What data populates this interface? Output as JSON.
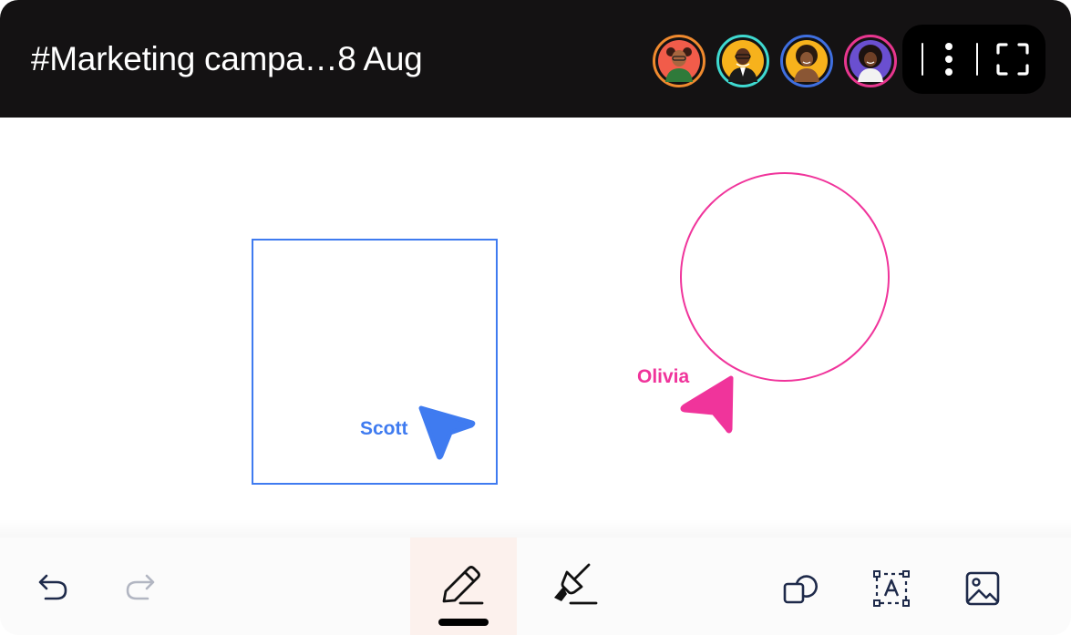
{
  "header": {
    "title": "#Marketing campa…8 Aug",
    "participants": [
      {
        "ring_color": "#f08a2e",
        "bg": "#f15c4a",
        "icon": "avatar-participant-1"
      },
      {
        "ring_color": "#3fd9d0",
        "bg": "#f7b21c",
        "icon": "avatar-participant-2"
      },
      {
        "ring_color": "#3f6fe0",
        "bg": "#f7b21c",
        "icon": "avatar-participant-3"
      },
      {
        "ring_color": "#e8368f",
        "bg": "#6a4fd0",
        "icon": "avatar-participant-4"
      }
    ],
    "actions": [
      "more-options-icon",
      "fullscreen-icon"
    ]
  },
  "canvas": {
    "cursors": [
      {
        "name": "Scott",
        "color": "#3f7bf0"
      },
      {
        "name": "Olivia",
        "color": "#f0349b"
      }
    ],
    "shapes": [
      {
        "type": "square",
        "color": "#3f7bf0"
      },
      {
        "type": "circle",
        "color": "#f0349b"
      }
    ]
  },
  "toolbar": {
    "tools": [
      "undo-icon",
      "redo-icon",
      "pen-icon",
      "highlighter-icon",
      "shapes-icon",
      "text-box-icon",
      "image-icon"
    ],
    "active_tool": "pen-icon",
    "active_color": "#fcf1ed"
  }
}
